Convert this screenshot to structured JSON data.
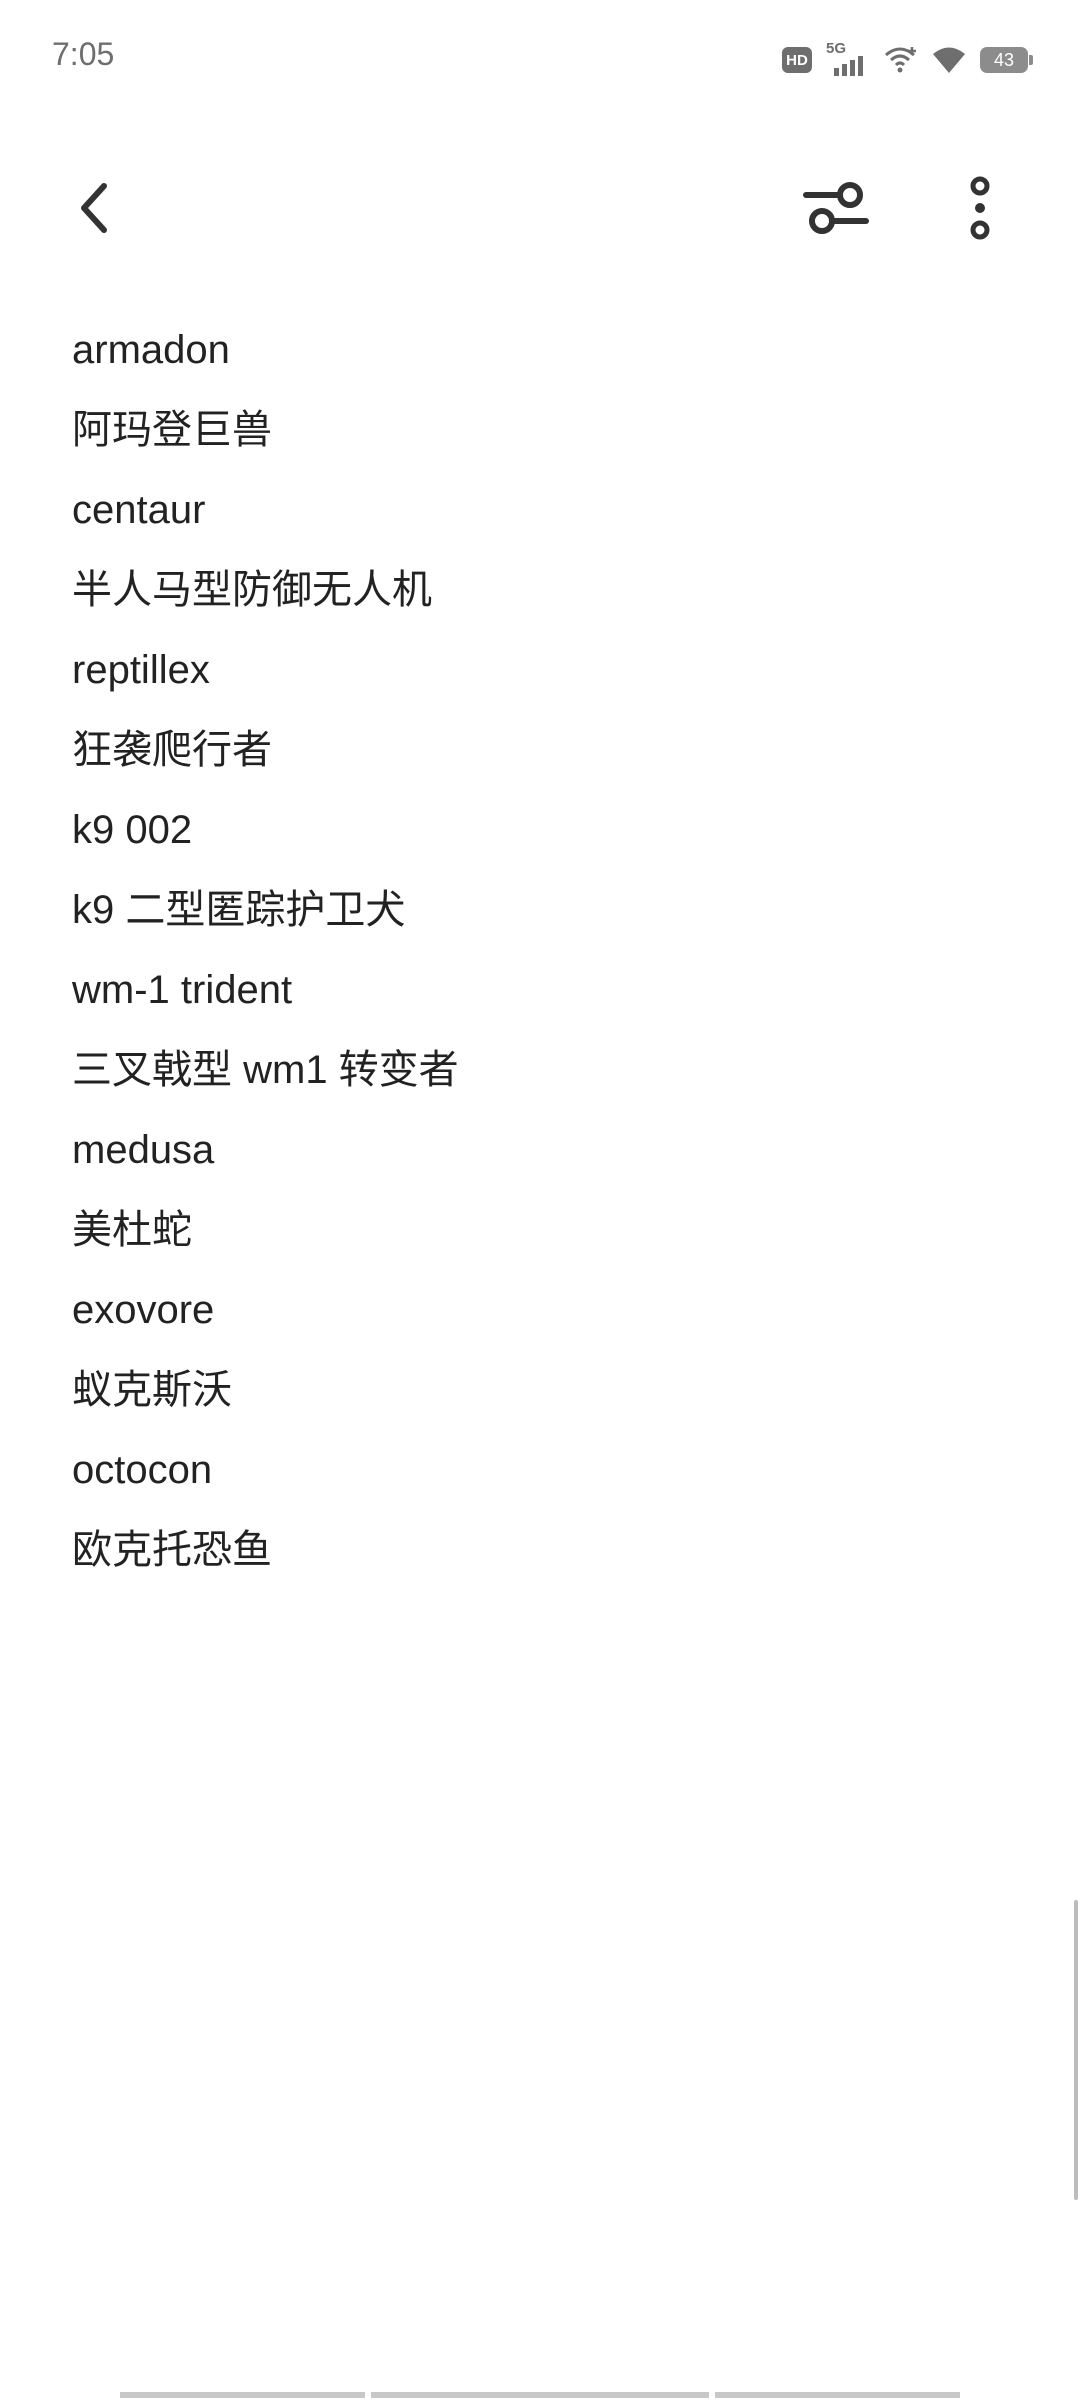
{
  "status_bar": {
    "time": "7:05",
    "hd_label": "HD",
    "network_label": "5G",
    "battery_level": "43",
    "icons": [
      "hd-icon",
      "signal-5g-icon",
      "wifi-plus-icon",
      "wifi-icon",
      "battery-icon"
    ]
  },
  "toolbar": {
    "back_icon": "chevron-left-icon",
    "filter_icon": "sliders-icon",
    "more_icon": "vertical-dots-icon"
  },
  "items": [
    "armadon",
    "阿玛登巨兽",
    "centaur",
    "半人马型防御无人机",
    "reptillex",
    "狂袭爬行者",
    "k9 002",
    "k9 二型匿踪护卫犬",
    "wm-1 trident",
    "三叉戟型 wm1 转变者",
    "medusa",
    "美杜蛇",
    "exovore",
    "蚁克斯沃",
    "octocon",
    "欧克托恐鱼"
  ],
  "colors": {
    "text": "#222222",
    "status_text": "#6e6e6e",
    "icon": "#333333",
    "scrollbar": "#bdbdbd"
  }
}
